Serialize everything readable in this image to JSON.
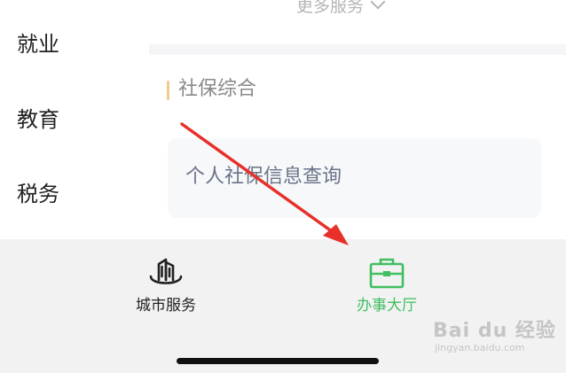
{
  "sidebar": {
    "items": [
      {
        "label": "就业"
      },
      {
        "label": "教育"
      },
      {
        "label": "税务"
      }
    ]
  },
  "main": {
    "more_services": "更多服务",
    "section_title": "社保综合",
    "service_item": "个人社保信息查询"
  },
  "tabbar": {
    "tabs": [
      {
        "label": "城市服务",
        "icon": "city-building-icon",
        "active": false
      },
      {
        "label": "办事大厅",
        "icon": "briefcase-icon",
        "active": true
      }
    ]
  },
  "watermark": {
    "text": "Bai du 经验",
    "sub": "jingyan.baidu.com"
  },
  "colors": {
    "active_green": "#3fbf61",
    "annotation_red": "#e8302a",
    "section_accent": "#f3c98e"
  }
}
